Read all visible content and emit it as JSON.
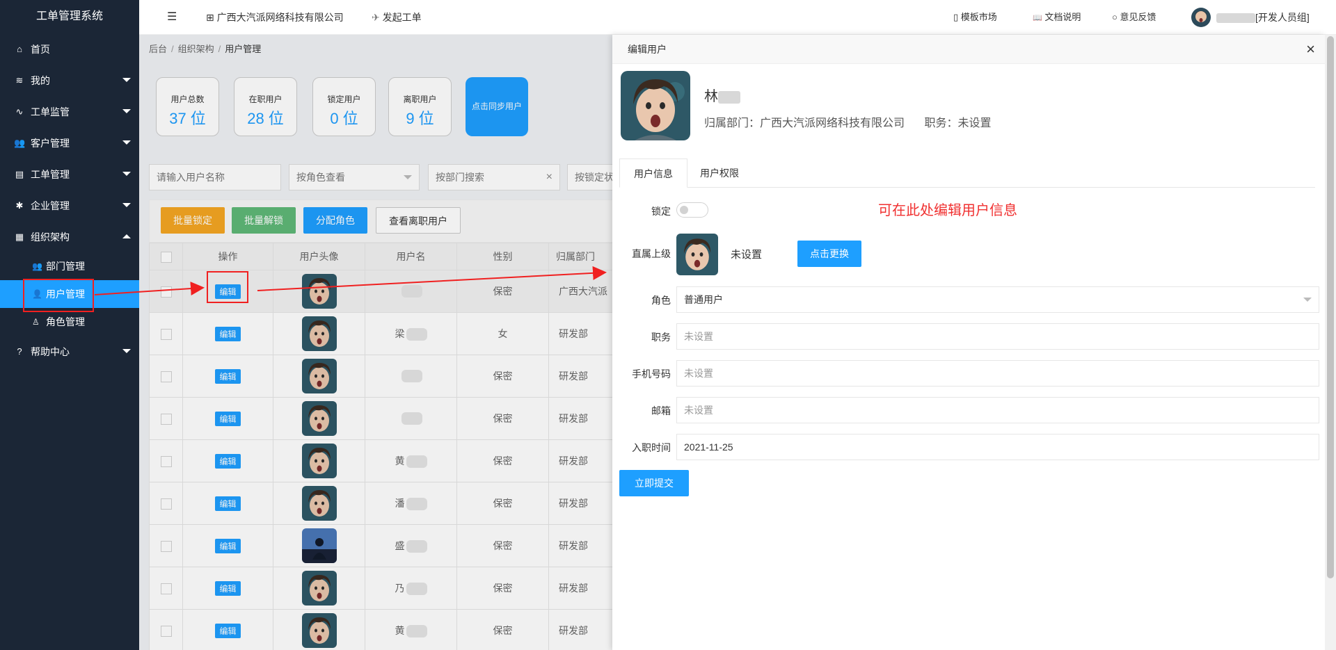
{
  "app_title": "工单管理系统",
  "sidebar": {
    "items": [
      {
        "label": "首页",
        "icon": "home-icon",
        "glyph": "⌂"
      },
      {
        "label": "我的",
        "icon": "layers-icon",
        "glyph": "≋"
      },
      {
        "label": "工单监管",
        "icon": "pulse-icon",
        "glyph": "∿"
      },
      {
        "label": "客户管理",
        "icon": "users-icon",
        "glyph": "👥"
      },
      {
        "label": "工单管理",
        "icon": "clipboard-icon",
        "glyph": "▤"
      },
      {
        "label": "企业管理",
        "icon": "gear-icon",
        "glyph": "✱"
      },
      {
        "label": "组织架构",
        "icon": "calendar-icon",
        "glyph": "▦"
      }
    ],
    "sub_items": [
      {
        "label": "部门管理",
        "icon": "group-icon",
        "glyph": "👥"
      },
      {
        "label": "用户管理",
        "icon": "user-icon",
        "glyph": "👤"
      },
      {
        "label": "角色管理",
        "icon": "person-outline-icon",
        "glyph": "♙"
      }
    ],
    "help": {
      "label": "帮助中心",
      "glyph": "?"
    }
  },
  "header": {
    "menu_glyph": "☰",
    "company": "广西大汽派网络科技有限公司",
    "company_glyph": "⊞",
    "new_ticket": "发起工单",
    "new_ticket_glyph": "✈",
    "template_market": "模板市场",
    "template_glyph": "▯",
    "docs": "文档说明",
    "docs_glyph": "📖",
    "feedback": "意见反馈",
    "feedback_glyph": "○",
    "user_suffix": "[开发人员组]"
  },
  "breadcrumb": [
    "后台",
    "组织架构",
    "用户管理"
  ],
  "stats": [
    {
      "label": "用户总数",
      "value": "37 位"
    },
    {
      "label": "在职用户",
      "value": "28 位"
    },
    {
      "label": "锁定用户",
      "value": "0 位"
    },
    {
      "label": "离职用户",
      "value": "9 位"
    }
  ],
  "sync_button": "点击同步用户",
  "filters": {
    "name_placeholder": "请输入用户名称",
    "role": "按角色查看",
    "dept": "按部门搜索",
    "lock": "按锁定状"
  },
  "toolbar": {
    "batch_lock": "批量锁定",
    "batch_unlock": "批量解锁",
    "assign_role": "分配角色",
    "view_left": "查看离职用户"
  },
  "colors": {
    "lock": "#f5a623",
    "unlock": "#5fb878",
    "role": "#1e9fff",
    "accent": "#1e9fff",
    "sidebar": "#1b2636",
    "annotation": "#f03030"
  },
  "table": {
    "headers": [
      "操作",
      "用户头像",
      "用户名",
      "性别",
      "归属部门"
    ],
    "edit_label": "编辑",
    "rows": [
      {
        "name": "",
        "gender": "保密",
        "dept": "广西大汽派"
      },
      {
        "name": "梁",
        "gender": "女",
        "dept": "研发部"
      },
      {
        "name": "",
        "gender": "保密",
        "dept": "研发部"
      },
      {
        "name": "",
        "gender": "保密",
        "dept": "研发部"
      },
      {
        "name": "黄",
        "gender": "保密",
        "dept": "研发部"
      },
      {
        "name": "潘",
        "gender": "保密",
        "dept": "研发部"
      },
      {
        "name": "盛",
        "gender": "保密",
        "dept": "研发部"
      },
      {
        "name": "乃",
        "gender": "保密",
        "dept": "研发部"
      },
      {
        "name": "黄",
        "gender": "保密",
        "dept": "研发部"
      }
    ]
  },
  "panel": {
    "title": "编辑用户",
    "close": "×",
    "name": "林",
    "dept_line": "归属部门：广西大汽派网络科技有限公司",
    "job_line": "职务：未设置",
    "tabs": [
      "用户信息",
      "用户权限"
    ],
    "labels": {
      "lock": "锁定",
      "supervisor": "直属上级",
      "role": "角色",
      "job": "职务",
      "phone": "手机号码",
      "email": "邮箱",
      "hire": "入职时间"
    },
    "supervisor_value": "未设置",
    "change_button": "点击更换",
    "role_value": "普通用户",
    "job_placeholder": "未设置",
    "phone_placeholder": "未设置",
    "email_placeholder": "未设置",
    "hire_value": "2021-11-25",
    "submit": "立即提交",
    "annotation": "可在此处编辑用户信息"
  }
}
